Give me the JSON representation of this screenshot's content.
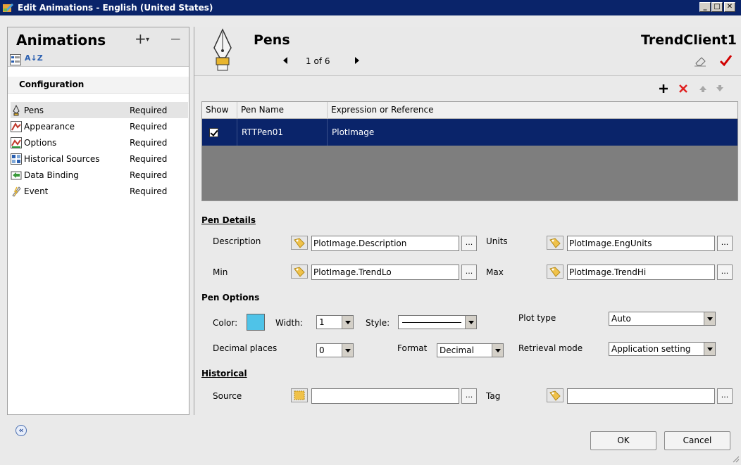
{
  "window": {
    "title": "Edit Animations - English (United States)",
    "minimize": "_",
    "maximize": "□",
    "close": "✕"
  },
  "sidebar": {
    "heading": "Animations",
    "add_label": "+",
    "add_dropdown": "▾",
    "remove_label": "−",
    "sort_label": "A↓Z",
    "section_label": "Configuration",
    "items": [
      {
        "label": "Pens",
        "status": "Required",
        "icon": "pen-icon"
      },
      {
        "label": "Appearance",
        "status": "Required",
        "icon": "appearance-icon"
      },
      {
        "label": "Options",
        "status": "Required",
        "icon": "options-icon"
      },
      {
        "label": "Historical Sources",
        "status": "Required",
        "icon": "historical-sources-icon"
      },
      {
        "label": "Data Binding",
        "status": "Required",
        "icon": "data-binding-icon"
      },
      {
        "label": "Event",
        "status": "Required",
        "icon": "event-icon"
      }
    ],
    "collapse_label": "«"
  },
  "header": {
    "title": "Pens",
    "pager": "1 of 6",
    "object_name": "TrendClient1"
  },
  "grid": {
    "columns": [
      "Show",
      "Pen Name",
      "Expression or Reference"
    ],
    "rows": [
      {
        "show": true,
        "pen_name": "RTTPen01",
        "expression": "PlotImage"
      }
    ]
  },
  "pen_details": {
    "title": "Pen Details",
    "description_label": "Description",
    "description_value": "PlotImage.Description",
    "units_label": "Units",
    "units_value": "PlotImage.EngUnits",
    "min_label": "Min",
    "min_value": "PlotImage.TrendLo",
    "max_label": "Max",
    "max_value": "PlotImage.TrendHi",
    "browse": "..."
  },
  "pen_options": {
    "title": "Pen Options",
    "color_label": "Color:",
    "color_value": "#4fc3e8",
    "width_label": "Width:",
    "width_value": "1",
    "style_label": "Style:",
    "plot_type_label": "Plot type",
    "plot_type_value": "Auto",
    "decimal_label": "Decimal places",
    "decimal_value": "0",
    "format_label": "Format",
    "format_value": "Decimal",
    "retrieval_label": "Retrieval mode",
    "retrieval_value": "Application setting"
  },
  "historical": {
    "title": "Historical",
    "source_label": "Source",
    "source_value": "",
    "tag_label": "Tag",
    "tag_value": ""
  },
  "footer": {
    "ok_label": "OK",
    "cancel_label": "Cancel"
  }
}
